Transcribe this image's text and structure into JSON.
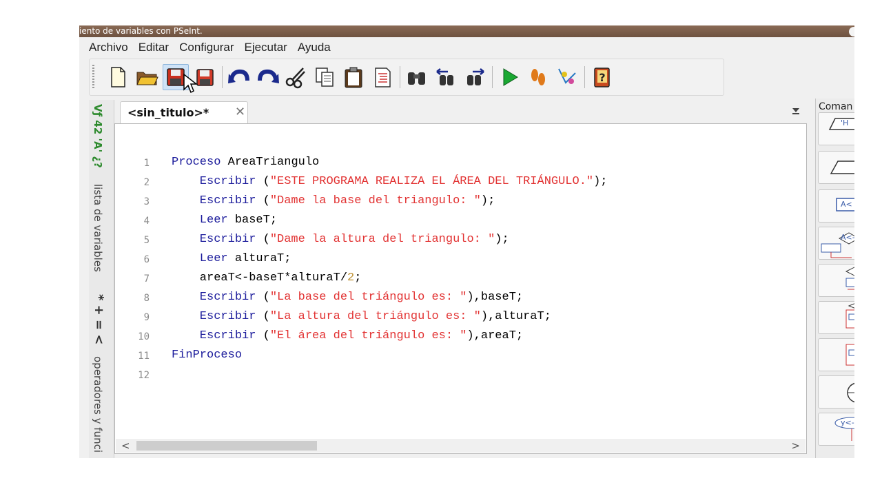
{
  "window": {
    "title": "iento de variables con PSeInt."
  },
  "menu": [
    "Archivo",
    "Editar",
    "Configurar",
    "Ejecutar",
    "Ayuda"
  ],
  "side_panels": {
    "variables_symbols": "Vƒ 42 'A' ¿?",
    "variables_label": "lista de variables",
    "operators_symbols": "* + = <",
    "operators_label": "operadores y funci"
  },
  "tab": {
    "label": "<sin_titulo>*",
    "close": "✕"
  },
  "editor": {
    "line_numbers": [
      "1",
      "2",
      "3",
      "4",
      "5",
      "6",
      "7",
      "8",
      "9",
      "10",
      "11",
      "12"
    ],
    "lines": [
      [
        {
          "t": "Proceso ",
          "c": "kw"
        },
        {
          "t": "AreaTriangulo",
          "c": ""
        }
      ],
      [
        {
          "t": "    Escribir ",
          "c": "kw"
        },
        {
          "t": "(",
          "c": ""
        },
        {
          "t": "\"ESTE PROGRAMA REALIZA EL ÁREA DEL TRIÁNGULO.\"",
          "c": "str"
        },
        {
          "t": ");",
          "c": ""
        }
      ],
      [
        {
          "t": "    Escribir ",
          "c": "kw"
        },
        {
          "t": "(",
          "c": ""
        },
        {
          "t": "\"Dame la base del triangulo: \"",
          "c": "str"
        },
        {
          "t": ");",
          "c": ""
        }
      ],
      [
        {
          "t": "    Leer ",
          "c": "kw"
        },
        {
          "t": "baseT;",
          "c": ""
        }
      ],
      [
        {
          "t": "    Escribir ",
          "c": "kw"
        },
        {
          "t": "(",
          "c": ""
        },
        {
          "t": "\"Dame la altura del triangulo: \"",
          "c": "str"
        },
        {
          "t": ");",
          "c": ""
        }
      ],
      [
        {
          "t": "    Leer ",
          "c": "kw"
        },
        {
          "t": "alturaT;",
          "c": ""
        }
      ],
      [
        {
          "t": "    areaT<-baseT*alturaT/",
          "c": ""
        },
        {
          "t": "2",
          "c": "num"
        },
        {
          "t": ";",
          "c": ""
        }
      ],
      [
        {
          "t": "    Escribir ",
          "c": "kw"
        },
        {
          "t": "(",
          "c": ""
        },
        {
          "t": "\"La base del triángulo es: \"",
          "c": "str"
        },
        {
          "t": "),baseT;",
          "c": ""
        }
      ],
      [
        {
          "t": "    Escribir ",
          "c": "kw"
        },
        {
          "t": "(",
          "c": ""
        },
        {
          "t": "\"La altura del triángulo es: \"",
          "c": "str"
        },
        {
          "t": "),alturaT;",
          "c": ""
        }
      ],
      [
        {
          "t": "    Escribir ",
          "c": "kw"
        },
        {
          "t": "(",
          "c": ""
        },
        {
          "t": "\"El área del triángulo es: \"",
          "c": "str"
        },
        {
          "t": "),areaT;",
          "c": ""
        }
      ],
      [
        {
          "t": "FinProceso",
          "c": "kw"
        }
      ],
      []
    ]
  },
  "scroll": {
    "left": "<",
    "right": ">"
  },
  "commands": {
    "title": "Coman",
    "items": [
      "'H",
      "",
      "A<",
      "A<-B",
      "",
      "",
      "",
      "",
      "y<-f"
    ]
  },
  "colors": {
    "keyword": "#1c1c9c",
    "string": "#e23232",
    "number": "#bd8f30",
    "line_number": "#8a8a8a"
  }
}
